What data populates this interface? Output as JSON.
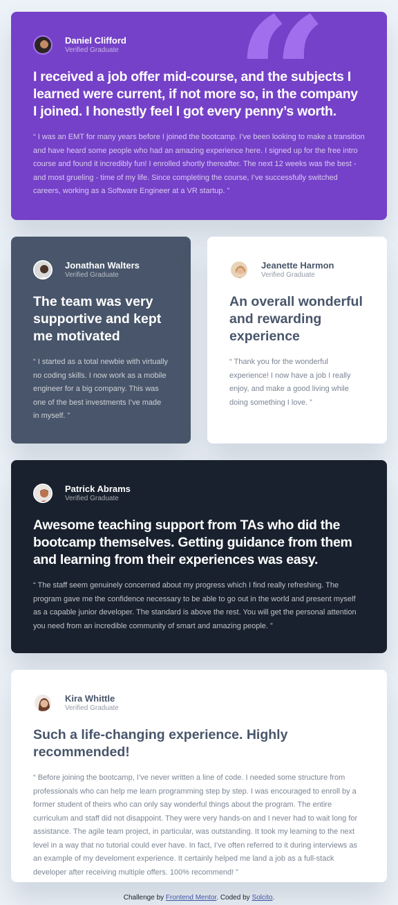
{
  "colors": {
    "page_bg": "#ecf2f8",
    "moderate_violet": "#7541c8",
    "blackish_blue": "#48556a",
    "very_dark_blackish_blue": "#19212e",
    "white": "#ffffff",
    "light_violet": "#a775f1"
  },
  "testimonials": [
    {
      "name": "Daniel Clifford",
      "status": "Verified Graduate",
      "headline": "I received a job offer mid-course, and the subjects I learned were current, if not more so, in the company I joined. I honestly feel I got every penny’s worth.",
      "body": "“ I was an EMT for many years before I joined the bootcamp. I’ve been looking to make a transition and have heard some people who had an amazing experience here. I signed up for the free intro course and found it incredibly fun! I enrolled shortly thereafter. The next 12 weeks was the best - and most grueling - time of my life. Since completing the course, I’ve successfully switched careers, working as a Software Engineer at a VR startup. ”",
      "avatar_icon": "avatar-daniel-icon"
    },
    {
      "name": "Jonathan Walters",
      "status": "Verified Graduate",
      "headline": "The team was very supportive and kept me motivated",
      "body": "“ I started as a total newbie with virtually no coding skills. I now work as a mobile engineer for a big company. This was one of the best investments I’ve made in myself. ”",
      "avatar_icon": "avatar-jonathan-icon"
    },
    {
      "name": "Jeanette Harmon",
      "status": "Verified Graduate",
      "headline": "An overall wonderful and rewarding experience",
      "body": "“ Thank you for the wonderful experience! I now have a job I really enjoy, and make a good living while doing something I love. ”",
      "avatar_icon": "avatar-jeanette-icon"
    },
    {
      "name": "Patrick Abrams",
      "status": "Verified Graduate",
      "headline": "Awesome teaching support from TAs who did the bootcamp themselves. Getting guidance from them and learning from their experiences was easy.",
      "body": "“ The staff seem genuinely concerned about my progress which I find really refreshing. The program gave me the confidence necessary to be able to go out in the world and present myself as a capable junior developer. The standard is above the rest. You will get the personal attention you need from an incredible community of smart and amazing people. ”",
      "avatar_icon": "avatar-patrick-icon"
    },
    {
      "name": "Kira Whittle",
      "status": "Verified Graduate",
      "headline": "Such a life-changing experience. Highly recommended!",
      "body": "“ Before joining the bootcamp, I’ve never written a line of code. I needed some structure from professionals who can help me learn programming step by step. I was encouraged to enroll by a former student of theirs who can only say wonderful things about the program. The entire curriculum and staff did not disappoint. They were very hands-on and I never had to wait long for assistance. The agile team project, in particular, was outstanding. It took my learning to the next level in a way that no tutorial could ever have. In fact, I’ve often referred to it during interviews as an example of my develoment experience. It certainly helped me land a job as a full-stack developer after receiving multiple offers. 100% recommend! ”",
      "avatar_icon": "avatar-kira-icon"
    }
  ],
  "footer": {
    "prefix": "Challenge by ",
    "link1": "Frontend Mentor",
    "middle": ". Coded by ",
    "link2": "Solcito",
    "suffix": "."
  }
}
